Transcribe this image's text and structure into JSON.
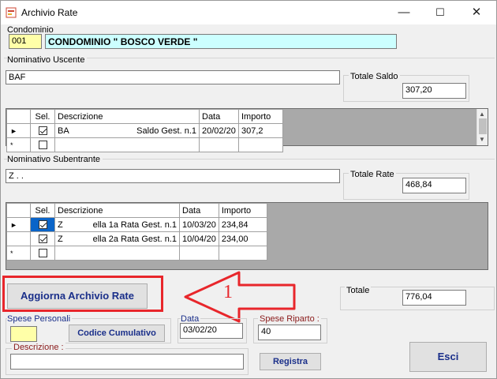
{
  "window": {
    "title": "Archivio Rate",
    "controls": {
      "minimize": "—",
      "maximize": "☐",
      "close": "✕"
    }
  },
  "condominio": {
    "label": "Condominio",
    "code": "001",
    "name": "CONDOMINIO \" BOSCO VERDE \""
  },
  "uscente": {
    "label": "Nominativo Uscente",
    "name": "BAF",
    "totale_label": "Totale Saldo",
    "totale_value": "307,20",
    "grid": {
      "columns": [
        "Sel.",
        "Descrizione",
        "Data",
        "Importo"
      ],
      "rows": [
        {
          "marker": "►",
          "checked": true,
          "descr_left": "BA",
          "descr_right": "Saldo Gest. n.1",
          "data": "20/02/20",
          "importo": "307,2"
        },
        {
          "marker": "*",
          "checked": false,
          "descr_left": "",
          "descr_right": "",
          "data": "",
          "importo": ""
        }
      ]
    }
  },
  "subentrante": {
    "label": "Nominativo Subentrante",
    "name": "Z . .",
    "totale_label": "Totale Rate",
    "totale_value": "468,84",
    "grid": {
      "columns": [
        "Sel.",
        "Descrizione",
        "Data",
        "Importo"
      ],
      "rows": [
        {
          "marker": "►",
          "checked": true,
          "descr_left": "Z",
          "descr_right": "ella 1a Rata Gest. n.1",
          "data": "10/03/20",
          "importo": "234,84"
        },
        {
          "marker": "",
          "checked": true,
          "descr_left": "Z",
          "descr_right": "ella 2a Rata Gest. n.1",
          "data": "10/04/20",
          "importo": "234,00"
        },
        {
          "marker": "*",
          "checked": false,
          "descr_left": "",
          "descr_right": "",
          "data": "",
          "importo": ""
        }
      ]
    }
  },
  "aggiorna_button": "Aggiorna Archivio Rate",
  "annotation": {
    "number": "1",
    "color": "#e8262b"
  },
  "totale": {
    "label": "Totale",
    "value": "776,04"
  },
  "spese_personali": {
    "label": "Spese Personali",
    "value": ""
  },
  "codice_cumulativo_button": "Codice Cumulativo",
  "data_field": {
    "label": "Data",
    "value": "03/02/20"
  },
  "spese_riparto": {
    "label": "Spese Riparto :",
    "value": "40"
  },
  "descrizione": {
    "label": "Descrizione :",
    "value": ""
  },
  "registra_button": "Registra",
  "esci_button": "Esci",
  "colors": {
    "condominio_name_bg": "#ccffff",
    "condominio_code_bg": "#ffffa8",
    "accent_blue": "#1a2f8a",
    "annotation_red": "#e8262b",
    "selection_blue": "#0a64c8"
  }
}
